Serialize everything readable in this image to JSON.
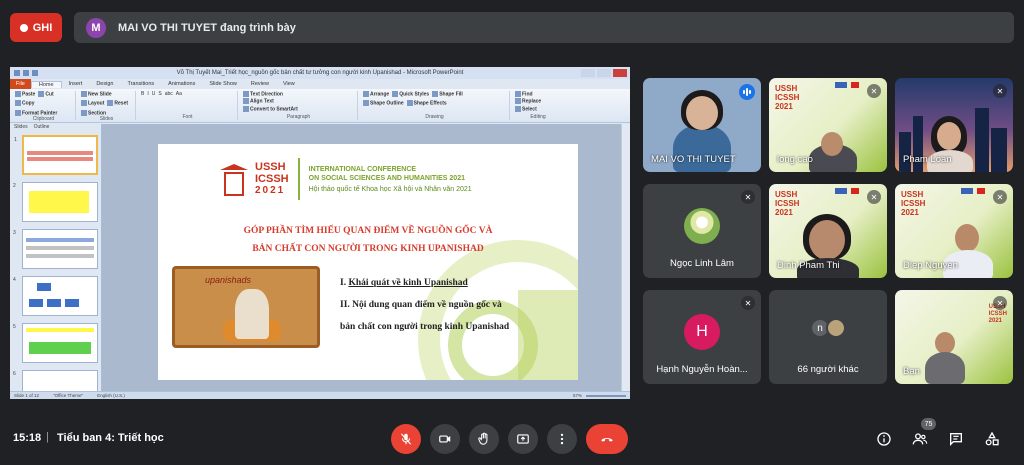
{
  "top": {
    "rec_label": "GHI",
    "presenter_initial": "M",
    "presenting_text": "MAI VO THI TUYET đang trình bày"
  },
  "ppt": {
    "window_title": "Võ Thị Tuyết Mai_Triết học_nguồn gốc bản chất tư tưởng con người kinh Upanishad - Microsoft PowerPoint",
    "file_tab": "File",
    "tabs": [
      "Home",
      "Insert",
      "Design",
      "Transitions",
      "Animations",
      "Slide Show",
      "Review",
      "View"
    ],
    "groups": [
      {
        "name": "Clipboard",
        "items": [
          "Paste",
          "Cut",
          "Copy",
          "Format Painter"
        ]
      },
      {
        "name": "Slides",
        "items": [
          "New Slide",
          "Layout",
          "Reset",
          "Section"
        ]
      },
      {
        "name": "Font",
        "items": [
          "B",
          "I",
          "U",
          "S",
          "abc",
          "Aa"
        ]
      },
      {
        "name": "Paragraph",
        "items": [
          "Text Direction",
          "Align Text",
          "Convert to SmartArt"
        ]
      },
      {
        "name": "Drawing",
        "items": [
          "Arrange",
          "Quick Styles",
          "Shape Fill",
          "Shape Outline",
          "Shape Effects"
        ]
      },
      {
        "name": "Editing",
        "items": [
          "Find",
          "Replace",
          "Select"
        ]
      }
    ],
    "pane_tabs": [
      "Slides",
      "Outline"
    ],
    "thumb_numbers": [
      "1",
      "2",
      "3",
      "4",
      "5",
      "6"
    ],
    "status": {
      "slide": "Slide 1 of 12",
      "theme": "\"Office Theme\"",
      "lang": "English (U.S.)",
      "zoom": "57%"
    }
  },
  "slide": {
    "acronym1": "USSH",
    "acronym2": "ICSSH",
    "year": "2021",
    "conf_line1": "INTERNATIONAL CONFERENCE",
    "conf_line2": "ON SOCIAL SCIENCES AND HUMANITIES 2021",
    "conf_vn": "Hội thảo quốc tế Khoa học Xã hội và Nhân văn 2021",
    "title1": "GÓP PHẦN TÌM HIỂU QUAN ĐIỂM VỀ NGUỒN GỐC VÀ",
    "title2": "BẢN CHẤT CON NGƯỜI TRONG KINH UPANISHAD",
    "image_word": "upanishads",
    "point1_prefix": "I. ",
    "point1": "Khái quát về kinh Upanishad",
    "point2a": "II. Nội dung quan điểm về nguồn gốc và",
    "point2b": "bản chất con người trong kinh Upanishad"
  },
  "participants": [
    {
      "name": "MAI VO THI TUYET",
      "speaking": true
    },
    {
      "name": "long cao",
      "muted": true
    },
    {
      "name": "Pham Loan",
      "muted": true
    },
    {
      "name": "Ngọc Linh Lâm",
      "muted": true
    },
    {
      "name": "Dinh Pham Thi",
      "muted": true
    },
    {
      "name": "Diep Nguyen",
      "muted": true
    },
    {
      "name": "Hạnh Nguyễn Hoàn...",
      "muted": true,
      "initial": "H"
    },
    {
      "name": "66 người khác",
      "initial": "n"
    },
    {
      "name": "Bạn",
      "muted": true
    }
  ],
  "bottom": {
    "time": "15:18",
    "separator": "|",
    "meeting": "Tiểu ban 4: Triết học",
    "people_count": "75"
  },
  "icons": {
    "mic_off": "mic-off-icon",
    "camera": "camera-icon",
    "raise_hand": "raise-hand-icon",
    "present": "present-icon",
    "more": "more-options-icon",
    "end_call": "end-call-icon",
    "info": "info-icon",
    "people": "people-icon",
    "chat": "chat-icon",
    "activities": "activities-icon"
  },
  "colors": {
    "record": "#d93025",
    "end_call": "#ea4335",
    "speaking": "#1a73e8",
    "avatar_h": "#d81b60"
  }
}
